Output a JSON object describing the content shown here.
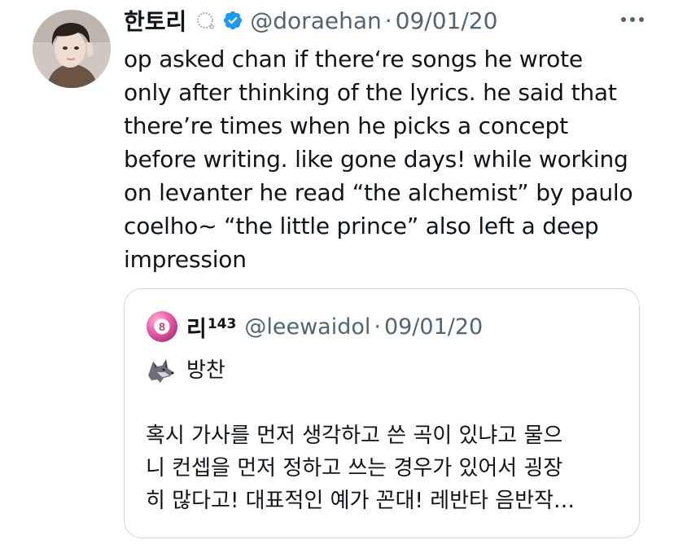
{
  "tweet": {
    "display_name": "한토리",
    "name_emoji": "thought-balloon-icon",
    "verified": "verified-badge-icon",
    "handle": "@doraehan",
    "separator": "·",
    "date": "09/01/20",
    "more_icon": "more-options-icon",
    "text": "op asked chan if there‘re songs he wrote\nonly after thinking of the lyrics. he said that\nthere’re times when he picks a concept\nbefore writing. like gone days! while working\non levanter he read “the alchemist” by paulo\ncoelho~ “the little prince” also left a deep\nimpression"
  },
  "quote": {
    "display_name": "리",
    "name_sup": "143",
    "avatar_icon": "pool-eight-ball-icon",
    "handle": "@leewaidol",
    "separator": "·",
    "date": "09/01/20",
    "emoji": "wolf-icon",
    "first_line": "방찬",
    "body": "혹시 가사를 먼저 생각하고 쓴 곡이 있냐고 물으\n니 컨셉을 먼저 정하고 쓰는 경우가 있어서 굉장\n히 많다고! 대표적인 예가 꼰대! 레반타 음반작…"
  },
  "colors": {
    "text": "#0f1419",
    "secondary": "#536471",
    "verified": "#1d9bf0",
    "border": "#cfd9de",
    "eight_ball": "#e85aa8"
  }
}
